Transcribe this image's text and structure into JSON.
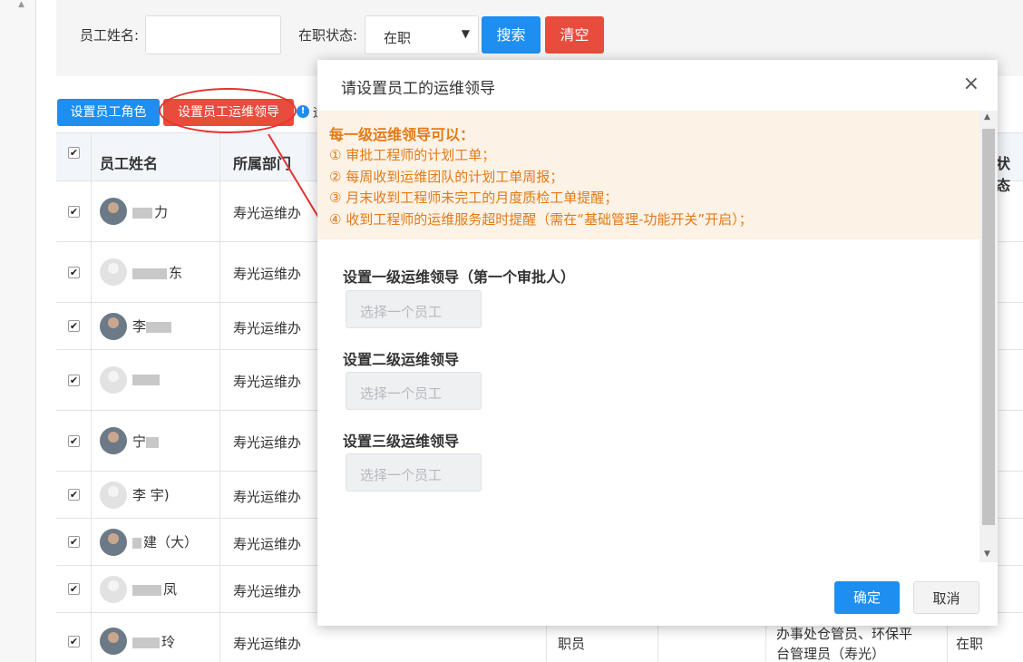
{
  "filter": {
    "name_label": "员工姓名:",
    "status_label": "在职状态:",
    "status_value": "在职",
    "search_label": "搜索",
    "clear_label": "清空"
  },
  "toolbar": {
    "set_role_label": "设置员工角色",
    "set_lead_label": "设置员工运维领导",
    "more_label": "运"
  },
  "table": {
    "headers": {
      "name": "员工姓名",
      "dept": "所属部门",
      "status_partial": "状态"
    },
    "rows": [
      {
        "name": "力",
        "dept": "寿光运维办",
        "avatar": "photo",
        "checked": "✔"
      },
      {
        "name": "东",
        "dept": "寿光运维办",
        "avatar": "default",
        "checked": "✔"
      },
      {
        "name": "李",
        "dept": "寿光运维办",
        "avatar": "photo",
        "checked": "✔"
      },
      {
        "name": "",
        "dept": "寿光运维办",
        "avatar": "default",
        "checked": "✔"
      },
      {
        "name": "宁",
        "dept": "寿光运维办",
        "avatar": "photo",
        "checked": "✔"
      },
      {
        "name": "李 宇)",
        "dept": "寿光运维办",
        "avatar": "default",
        "checked": "✔"
      },
      {
        "name": "建（大）",
        "dept": "寿光运维办",
        "avatar": "photo",
        "checked": "✔"
      },
      {
        "name": "凤",
        "dept": "寿光运维办",
        "avatar": "default",
        "checked": "✔"
      },
      {
        "name": "玲",
        "dept": "寿光运维办",
        "avatar": "photo",
        "checked": "✔"
      }
    ],
    "last_row": {
      "position": "职员",
      "role_line1": "办事处仓管员、环保平",
      "role_line2": "台管理员（寿光）",
      "status": "在职"
    }
  },
  "modal": {
    "title": "请设置员工的运维领导",
    "close_icon": "×",
    "notice_title": "每一级运维领导可以：",
    "notice_lines": [
      "① 审批工程师的计划工单；",
      "② 每周收到运维团队的计划工单周报；",
      "③ 月末收到工程师未完工的月度质检工单提醒；",
      "④ 收到工程师的运维服务超时提醒（需在“基础管理-功能开关”开启）；"
    ],
    "fields": [
      {
        "label": "设置一级运维领导（第一个审批人）",
        "placeholder": "选择一个员工"
      },
      {
        "label": "设置二级运维领导",
        "placeholder": "选择一个员工"
      },
      {
        "label": "设置三级运维领导",
        "placeholder": "选择一个员工"
      }
    ],
    "ok_label": "确定",
    "cancel_label": "取消"
  },
  "colors": {
    "primary": "#1e8ff0",
    "danger": "#e84c3d",
    "notice_text": "#e37a17",
    "notice_bg": "#fdf2e6"
  }
}
